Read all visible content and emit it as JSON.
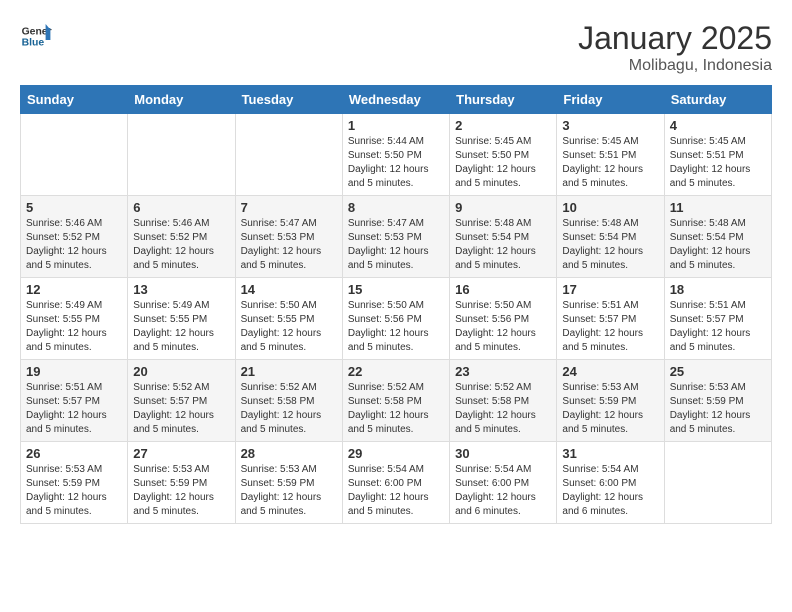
{
  "header": {
    "logo_line1": "General",
    "logo_line2": "Blue",
    "title": "January 2025",
    "subtitle": "Molibagu, Indonesia"
  },
  "calendar": {
    "weekdays": [
      "Sunday",
      "Monday",
      "Tuesday",
      "Wednesday",
      "Thursday",
      "Friday",
      "Saturday"
    ],
    "weeks": [
      [
        {
          "day": "",
          "info": ""
        },
        {
          "day": "",
          "info": ""
        },
        {
          "day": "",
          "info": ""
        },
        {
          "day": "1",
          "info": "Sunrise: 5:44 AM\nSunset: 5:50 PM\nDaylight: 12 hours\nand 5 minutes."
        },
        {
          "day": "2",
          "info": "Sunrise: 5:45 AM\nSunset: 5:50 PM\nDaylight: 12 hours\nand 5 minutes."
        },
        {
          "day": "3",
          "info": "Sunrise: 5:45 AM\nSunset: 5:51 PM\nDaylight: 12 hours\nand 5 minutes."
        },
        {
          "day": "4",
          "info": "Sunrise: 5:45 AM\nSunset: 5:51 PM\nDaylight: 12 hours\nand 5 minutes."
        }
      ],
      [
        {
          "day": "5",
          "info": "Sunrise: 5:46 AM\nSunset: 5:52 PM\nDaylight: 12 hours\nand 5 minutes."
        },
        {
          "day": "6",
          "info": "Sunrise: 5:46 AM\nSunset: 5:52 PM\nDaylight: 12 hours\nand 5 minutes."
        },
        {
          "day": "7",
          "info": "Sunrise: 5:47 AM\nSunset: 5:53 PM\nDaylight: 12 hours\nand 5 minutes."
        },
        {
          "day": "8",
          "info": "Sunrise: 5:47 AM\nSunset: 5:53 PM\nDaylight: 12 hours\nand 5 minutes."
        },
        {
          "day": "9",
          "info": "Sunrise: 5:48 AM\nSunset: 5:54 PM\nDaylight: 12 hours\nand 5 minutes."
        },
        {
          "day": "10",
          "info": "Sunrise: 5:48 AM\nSunset: 5:54 PM\nDaylight: 12 hours\nand 5 minutes."
        },
        {
          "day": "11",
          "info": "Sunrise: 5:48 AM\nSunset: 5:54 PM\nDaylight: 12 hours\nand 5 minutes."
        }
      ],
      [
        {
          "day": "12",
          "info": "Sunrise: 5:49 AM\nSunset: 5:55 PM\nDaylight: 12 hours\nand 5 minutes."
        },
        {
          "day": "13",
          "info": "Sunrise: 5:49 AM\nSunset: 5:55 PM\nDaylight: 12 hours\nand 5 minutes."
        },
        {
          "day": "14",
          "info": "Sunrise: 5:50 AM\nSunset: 5:55 PM\nDaylight: 12 hours\nand 5 minutes."
        },
        {
          "day": "15",
          "info": "Sunrise: 5:50 AM\nSunset: 5:56 PM\nDaylight: 12 hours\nand 5 minutes."
        },
        {
          "day": "16",
          "info": "Sunrise: 5:50 AM\nSunset: 5:56 PM\nDaylight: 12 hours\nand 5 minutes."
        },
        {
          "day": "17",
          "info": "Sunrise: 5:51 AM\nSunset: 5:57 PM\nDaylight: 12 hours\nand 5 minutes."
        },
        {
          "day": "18",
          "info": "Sunrise: 5:51 AM\nSunset: 5:57 PM\nDaylight: 12 hours\nand 5 minutes."
        }
      ],
      [
        {
          "day": "19",
          "info": "Sunrise: 5:51 AM\nSunset: 5:57 PM\nDaylight: 12 hours\nand 5 minutes."
        },
        {
          "day": "20",
          "info": "Sunrise: 5:52 AM\nSunset: 5:57 PM\nDaylight: 12 hours\nand 5 minutes."
        },
        {
          "day": "21",
          "info": "Sunrise: 5:52 AM\nSunset: 5:58 PM\nDaylight: 12 hours\nand 5 minutes."
        },
        {
          "day": "22",
          "info": "Sunrise: 5:52 AM\nSunset: 5:58 PM\nDaylight: 12 hours\nand 5 minutes."
        },
        {
          "day": "23",
          "info": "Sunrise: 5:52 AM\nSunset: 5:58 PM\nDaylight: 12 hours\nand 5 minutes."
        },
        {
          "day": "24",
          "info": "Sunrise: 5:53 AM\nSunset: 5:59 PM\nDaylight: 12 hours\nand 5 minutes."
        },
        {
          "day": "25",
          "info": "Sunrise: 5:53 AM\nSunset: 5:59 PM\nDaylight: 12 hours\nand 5 minutes."
        }
      ],
      [
        {
          "day": "26",
          "info": "Sunrise: 5:53 AM\nSunset: 5:59 PM\nDaylight: 12 hours\nand 5 minutes."
        },
        {
          "day": "27",
          "info": "Sunrise: 5:53 AM\nSunset: 5:59 PM\nDaylight: 12 hours\nand 5 minutes."
        },
        {
          "day": "28",
          "info": "Sunrise: 5:53 AM\nSunset: 5:59 PM\nDaylight: 12 hours\nand 5 minutes."
        },
        {
          "day": "29",
          "info": "Sunrise: 5:54 AM\nSunset: 6:00 PM\nDaylight: 12 hours\nand 5 minutes."
        },
        {
          "day": "30",
          "info": "Sunrise: 5:54 AM\nSunset: 6:00 PM\nDaylight: 12 hours\nand 6 minutes."
        },
        {
          "day": "31",
          "info": "Sunrise: 5:54 AM\nSunset: 6:00 PM\nDaylight: 12 hours\nand 6 minutes."
        },
        {
          "day": "",
          "info": ""
        }
      ]
    ]
  }
}
